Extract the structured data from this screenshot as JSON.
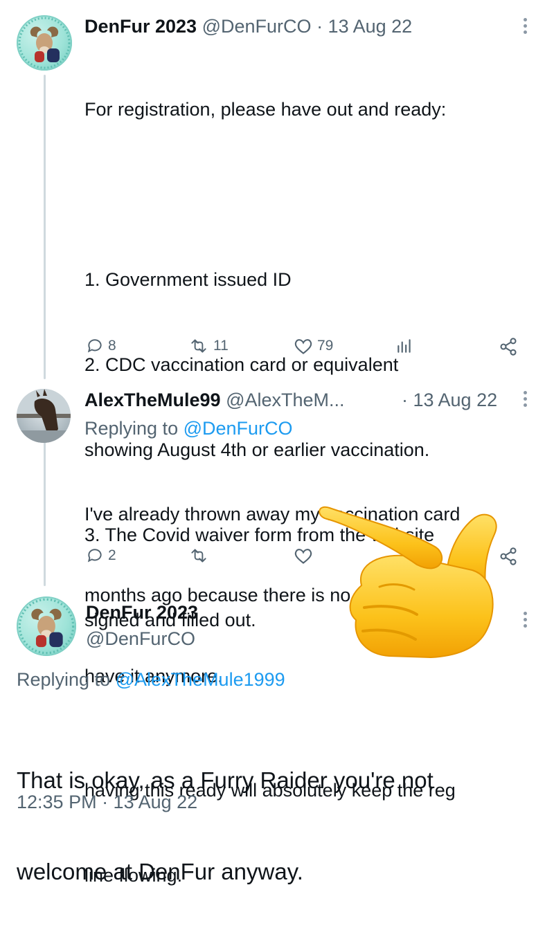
{
  "tweets": [
    {
      "display_name": "DenFur 2023",
      "handle": "@DenFurCO",
      "date": "· 13 Aug 22",
      "lines": [
        "For registration, please have out and ready:",
        "",
        "1. Government issued ID",
        "2. CDC vaccination card or equivalent",
        "showing August 4th or earlier vaccination.",
        "3. The Covid waiver form from the website",
        "signed and filled out.",
        "",
        "having this ready will absolutely keep the reg",
        "line flowing."
      ],
      "replies": "8",
      "retweets": "11",
      "likes": "79"
    },
    {
      "display_name": "AlexTheMule99",
      "handle": "@AlexTheM...",
      "date": "· 13 Aug 22",
      "replying_label": "Replying to",
      "replying_handle": "@DenFurCO",
      "lines": [
        "I've already thrown away my vaccination card",
        "months ago because there is no reason to",
        "have it anymore."
      ],
      "replies": "2"
    },
    {
      "display_name": "DenFur 2023",
      "handle": "@DenFurCO",
      "replying_label": "Replying to",
      "replying_handle": "@AlexTheMule1999",
      "lines": [
        "That is okay, as a Furry Raider you're not",
        "welcome at DenFur anyway."
      ],
      "timestamp": "12:35 PM · 13 Aug 22"
    }
  ],
  "icons": {
    "reply": "reply-icon",
    "retweet": "retweet-icon",
    "like": "heart-icon",
    "views": "views-icon",
    "share": "share-icon",
    "more": "more-icon",
    "overlay": "pointing-hand-emoji"
  },
  "colors": {
    "link": "#1d9bf0",
    "muted": "#536471",
    "thread_line": "#cfd9de",
    "avatar_bg": "#9ee3d8"
  }
}
